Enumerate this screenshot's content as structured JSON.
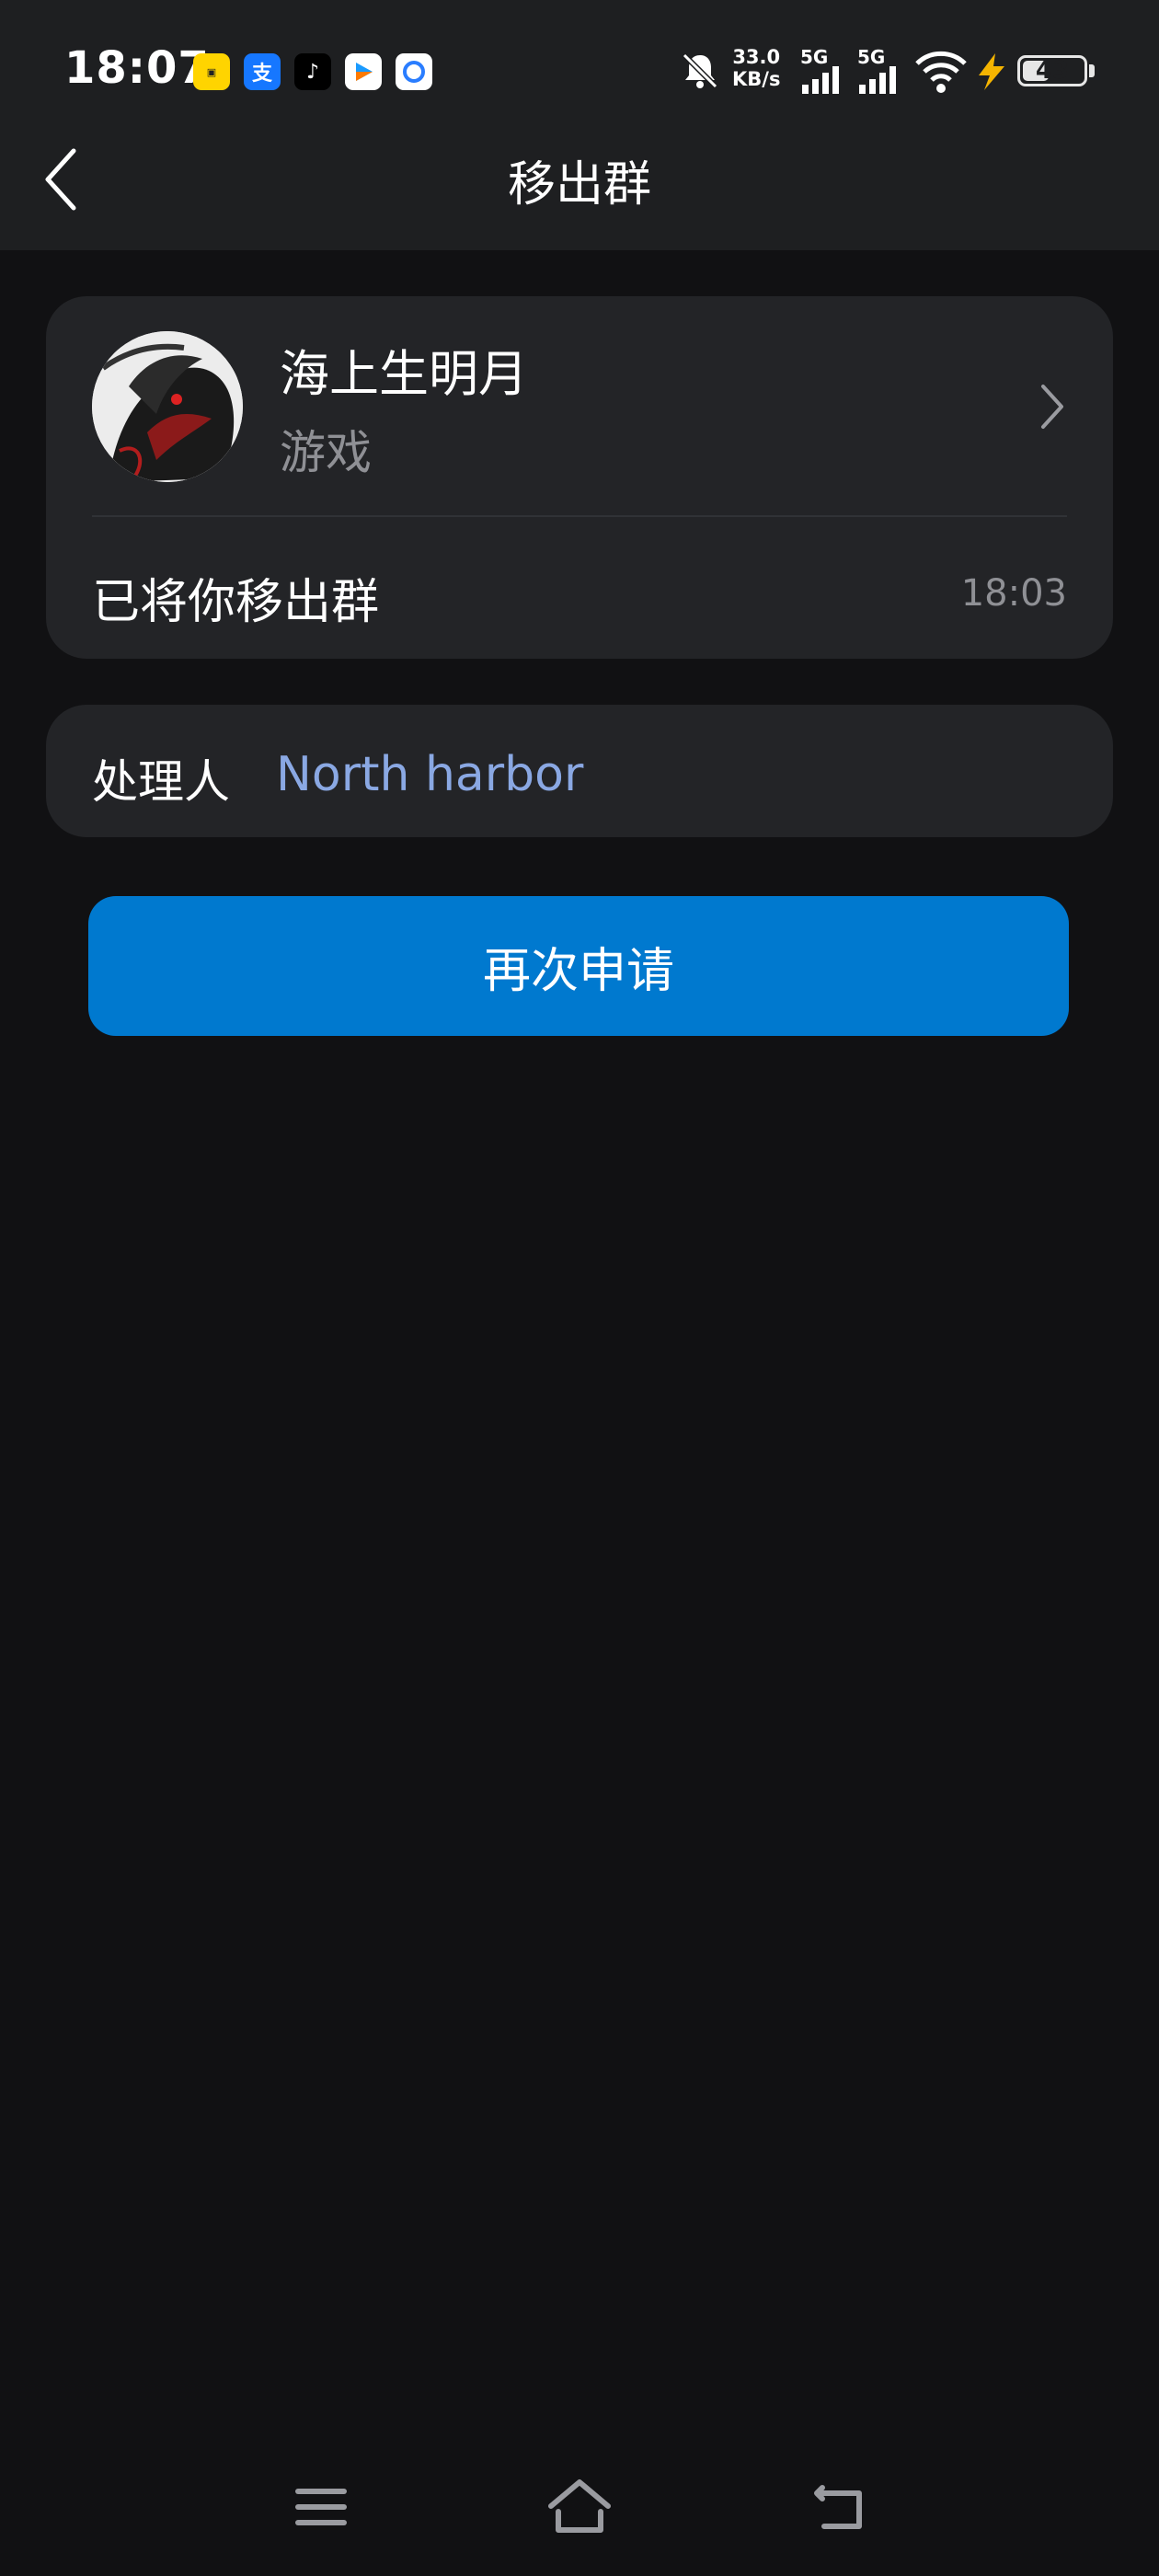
{
  "status_bar": {
    "time": "18:07",
    "app_icons": [
      "app-shortcut-yellow-icon",
      "alipay-icon",
      "tiktok-icon",
      "video-app-icon",
      "browser-app-icon"
    ],
    "speed_value": "33.0",
    "speed_unit": "KB/s",
    "sim1_label": "5G",
    "sim2_label": "5G",
    "battery_level": "43",
    "battery_fraction": 0.43
  },
  "header": {
    "title": "移出群"
  },
  "group_card": {
    "name": "海上生明月",
    "type": "游戏",
    "message": "已将你移出群",
    "time": "18:03"
  },
  "handler_card": {
    "label": "处理人",
    "name": "North harbor"
  },
  "actions": {
    "reapply_label": "再次申请"
  },
  "colors": {
    "primary_button": "#0079cf",
    "link": "#8aa8e3",
    "background": "#111113",
    "card": "#232427"
  }
}
